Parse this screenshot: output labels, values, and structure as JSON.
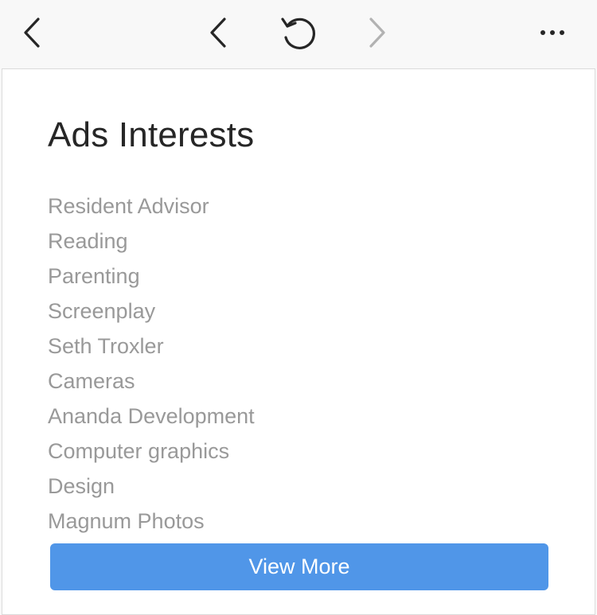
{
  "toolbar": {
    "close_icon": "chevron-left-icon",
    "back_icon": "chevron-left-icon",
    "reload_icon": "reload-icon",
    "forward_icon": "chevron-right-icon",
    "more_icon": "more-horizontal-icon",
    "forward_enabled": false
  },
  "page": {
    "title": "Ads Interests",
    "interests": [
      "Resident Advisor",
      "Reading",
      "Parenting",
      "Screenplay",
      "Seth Troxler",
      "Cameras",
      "Ananda Development",
      "Computer graphics",
      "Design",
      "Magnum Photos"
    ],
    "view_more_label": "View More"
  },
  "colors": {
    "accent": "#5096e8",
    "title_text": "#262626",
    "list_text": "#999999",
    "toolbar_bg": "#f8f8f8",
    "disabled_icon": "#b2b2b2"
  }
}
